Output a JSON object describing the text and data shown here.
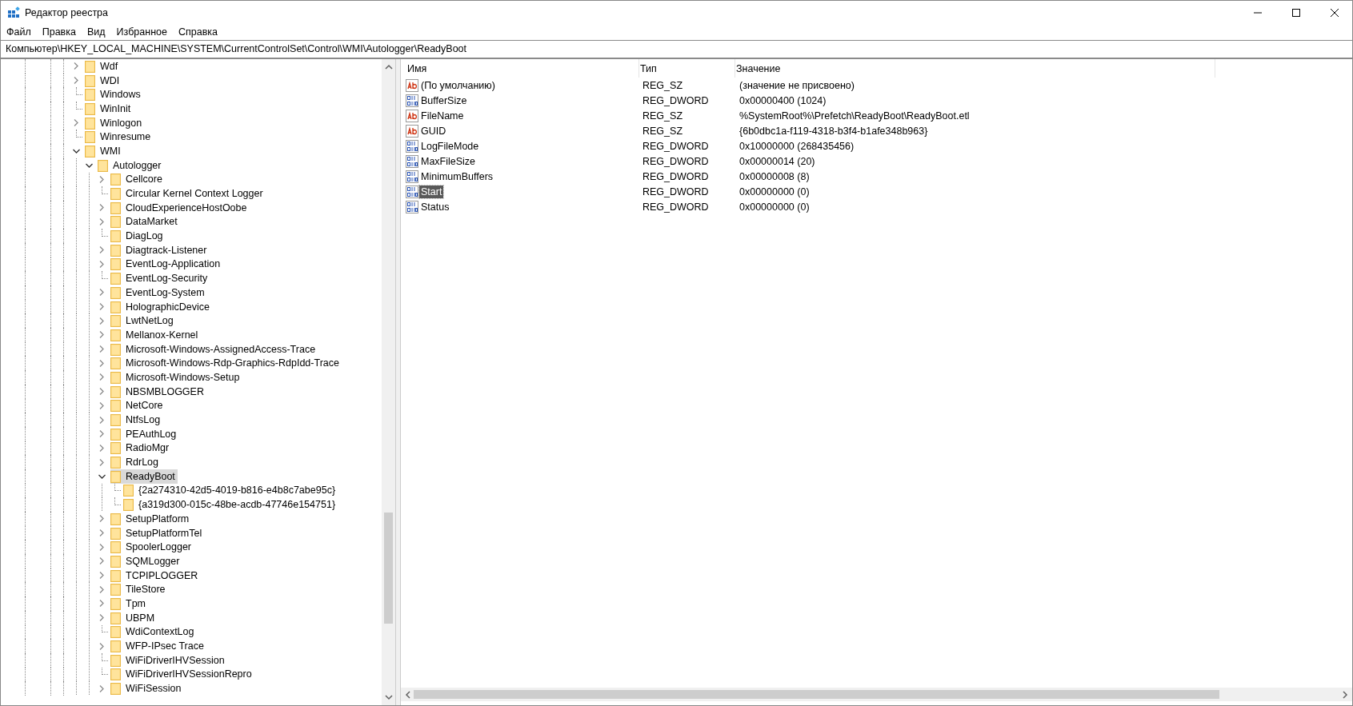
{
  "window": {
    "title": "Редактор реестра"
  },
  "menu": [
    {
      "label": "Файл"
    },
    {
      "label": "Правка"
    },
    {
      "label": "Вид"
    },
    {
      "label": "Избранное"
    },
    {
      "label": "Справка"
    }
  ],
  "address": "Компьютер\\HKEY_LOCAL_MACHINE\\SYSTEM\\CurrentControlSet\\Control\\WMI\\Autologger\\ReadyBoot",
  "tree": [
    {
      "label": "Wdf",
      "expandable": true,
      "expanded": false,
      "selected": false
    },
    {
      "label": "WDI",
      "expandable": true,
      "expanded": false,
      "selected": false
    },
    {
      "label": "Windows",
      "expandable": false,
      "selected": false
    },
    {
      "label": "WinInit",
      "expandable": false,
      "selected": false
    },
    {
      "label": "Winlogon",
      "expandable": true,
      "expanded": false,
      "selected": false
    },
    {
      "label": "Winresume",
      "expandable": false,
      "selected": false
    },
    {
      "label": "WMI",
      "expandable": true,
      "expanded": true,
      "selected": false,
      "children": [
        {
          "label": "Autologger",
          "expandable": true,
          "expanded": true,
          "selected": false,
          "children": [
            {
              "label": "Cellcore",
              "expandable": true,
              "expanded": false,
              "selected": false
            },
            {
              "label": "Circular Kernel Context Logger",
              "expandable": false,
              "selected": false
            },
            {
              "label": "CloudExperienceHostOobe",
              "expandable": true,
              "expanded": false,
              "selected": false
            },
            {
              "label": "DataMarket",
              "expandable": true,
              "expanded": false,
              "selected": false
            },
            {
              "label": "DiagLog",
              "expandable": false,
              "selected": false
            },
            {
              "label": "Diagtrack-Listener",
              "expandable": true,
              "expanded": false,
              "selected": false
            },
            {
              "label": "EventLog-Application",
              "expandable": true,
              "expanded": false,
              "selected": false
            },
            {
              "label": "EventLog-Security",
              "expandable": false,
              "selected": false
            },
            {
              "label": "EventLog-System",
              "expandable": true,
              "expanded": false,
              "selected": false
            },
            {
              "label": "HolographicDevice",
              "expandable": true,
              "expanded": false,
              "selected": false
            },
            {
              "label": "LwtNetLog",
              "expandable": true,
              "expanded": false,
              "selected": false
            },
            {
              "label": "Mellanox-Kernel",
              "expandable": true,
              "expanded": false,
              "selected": false
            },
            {
              "label": "Microsoft-Windows-AssignedAccess-Trace",
              "expandable": true,
              "expanded": false,
              "selected": false
            },
            {
              "label": "Microsoft-Windows-Rdp-Graphics-RdpIdd-Trace",
              "expandable": true,
              "expanded": false,
              "selected": false
            },
            {
              "label": "Microsoft-Windows-Setup",
              "expandable": true,
              "expanded": false,
              "selected": false
            },
            {
              "label": "NBSMBLOGGER",
              "expandable": true,
              "expanded": false,
              "selected": false
            },
            {
              "label": "NetCore",
              "expandable": true,
              "expanded": false,
              "selected": false
            },
            {
              "label": "NtfsLog",
              "expandable": true,
              "expanded": false,
              "selected": false
            },
            {
              "label": "PEAuthLog",
              "expandable": true,
              "expanded": false,
              "selected": false
            },
            {
              "label": "RadioMgr",
              "expandable": true,
              "expanded": false,
              "selected": false
            },
            {
              "label": "RdrLog",
              "expandable": true,
              "expanded": false,
              "selected": false
            },
            {
              "label": "ReadyBoot",
              "expandable": true,
              "expanded": true,
              "selected": true,
              "children": [
                {
                  "label": "{2a274310-42d5-4019-b816-e4b8c7abe95c}",
                  "expandable": false,
                  "selected": false
                },
                {
                  "label": "{a319d300-015c-48be-acdb-47746e154751}",
                  "expandable": false,
                  "selected": false
                }
              ]
            },
            {
              "label": "SetupPlatform",
              "expandable": true,
              "expanded": false,
              "selected": false
            },
            {
              "label": "SetupPlatformTel",
              "expandable": true,
              "expanded": false,
              "selected": false
            },
            {
              "label": "SpoolerLogger",
              "expandable": true,
              "expanded": false,
              "selected": false
            },
            {
              "label": "SQMLogger",
              "expandable": true,
              "expanded": false,
              "selected": false
            },
            {
              "label": "TCPIPLOGGER",
              "expandable": true,
              "expanded": false,
              "selected": false
            },
            {
              "label": "TileStore",
              "expandable": true,
              "expanded": false,
              "selected": false
            },
            {
              "label": "Tpm",
              "expandable": true,
              "expanded": false,
              "selected": false
            },
            {
              "label": "UBPM",
              "expandable": true,
              "expanded": false,
              "selected": false
            },
            {
              "label": "WdiContextLog",
              "expandable": false,
              "selected": false
            },
            {
              "label": "WFP-IPsec Trace",
              "expandable": true,
              "expanded": false,
              "selected": false
            },
            {
              "label": "WiFiDriverIHVSession",
              "expandable": false,
              "selected": false
            },
            {
              "label": "WiFiDriverIHVSessionRepro",
              "expandable": false,
              "selected": false
            },
            {
              "label": "WiFiSession",
              "expandable": true,
              "expanded": false,
              "selected": false
            }
          ]
        }
      ]
    }
  ],
  "columns": [
    "Имя",
    "Тип",
    "Значение"
  ],
  "values": [
    {
      "name": "(По умолчанию)",
      "kind": "string",
      "type": "REG_SZ",
      "data": "(значение не присвоено)",
      "selected": false
    },
    {
      "name": "BufferSize",
      "kind": "binary",
      "type": "REG_DWORD",
      "data": "0x00000400 (1024)",
      "selected": false
    },
    {
      "name": "FileName",
      "kind": "string",
      "type": "REG_SZ",
      "data": "%SystemRoot%\\Prefetch\\ReadyBoot\\ReadyBoot.etl",
      "selected": false
    },
    {
      "name": "GUID",
      "kind": "string",
      "type": "REG_SZ",
      "data": "{6b0dbc1a-f119-4318-b3f4-b1afe348b963}",
      "selected": false
    },
    {
      "name": "LogFileMode",
      "kind": "binary",
      "type": "REG_DWORD",
      "data": "0x10000000 (268435456)",
      "selected": false
    },
    {
      "name": "MaxFileSize",
      "kind": "binary",
      "type": "REG_DWORD",
      "data": "0x00000014 (20)",
      "selected": false
    },
    {
      "name": "MinimumBuffers",
      "kind": "binary",
      "type": "REG_DWORD",
      "data": "0x00000008 (8)",
      "selected": false
    },
    {
      "name": "Start",
      "kind": "binary",
      "type": "REG_DWORD",
      "data": "0x00000000 (0)",
      "selected": true
    },
    {
      "name": "Status",
      "kind": "binary",
      "type": "REG_DWORD",
      "data": "0x00000000 (0)",
      "selected": false
    }
  ]
}
